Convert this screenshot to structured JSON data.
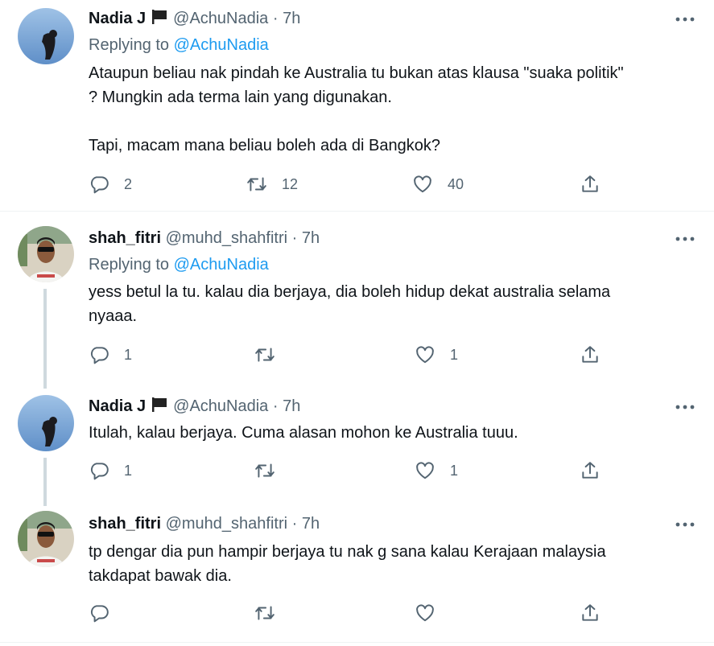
{
  "tweets": [
    {
      "name": "Nadia J",
      "has_flag": true,
      "handle": "@AchuNadia",
      "dot": "·",
      "time": "7h",
      "replying_prefix": "Replying to ",
      "replying_to": "@AchuNadia",
      "text_lines": [
        "Ataupun beliau nak pindah ke Australia tu bukan atas klausa \"suaka politik\"",
        "? Mungkin ada terma lain yang digunakan.",
        "",
        "Tapi, macam mana beliau boleh ada di Bangkok?"
      ],
      "reply_count": "2",
      "retweet_count": "12",
      "like_count": "40"
    },
    {
      "name": "shah_fitri",
      "has_flag": false,
      "handle": "@muhd_shahfitri",
      "dot": "·",
      "time": "7h",
      "replying_prefix": "Replying to ",
      "replying_to": "@AchuNadia",
      "text_lines": [
        "yess betul la tu. kalau dia berjaya, dia boleh hidup dekat australia selama",
        "nyaaa."
      ],
      "reply_count": "1",
      "retweet_count": "",
      "like_count": "1"
    },
    {
      "name": "Nadia J",
      "has_flag": true,
      "handle": "@AchuNadia",
      "dot": "·",
      "time": "7h",
      "text_lines": [
        "Itulah, kalau berjaya. Cuma alasan mohon ke Australia tuuu."
      ],
      "reply_count": "1",
      "retweet_count": "",
      "like_count": "1"
    },
    {
      "name": "shah_fitri",
      "has_flag": false,
      "handle": "@muhd_shahfitri",
      "dot": "·",
      "time": "7h",
      "text_lines": [
        "tp dengar dia pun hampir berjaya tu nak g sana kalau Kerajaan malaysia",
        "takdapat bawak dia."
      ],
      "reply_count": "",
      "retweet_count": "",
      "like_count": ""
    }
  ],
  "icons": {
    "reply": "reply-icon",
    "retweet": "retweet-icon",
    "like": "like-icon",
    "share": "share-icon",
    "more": "more-icon",
    "flag": "black-flag-icon"
  },
  "colors": {
    "text": "#0f1419",
    "secondary": "#536471",
    "link": "#1d9bf0",
    "thread_line": "#cfd9de",
    "divider": "#eff3f4"
  }
}
